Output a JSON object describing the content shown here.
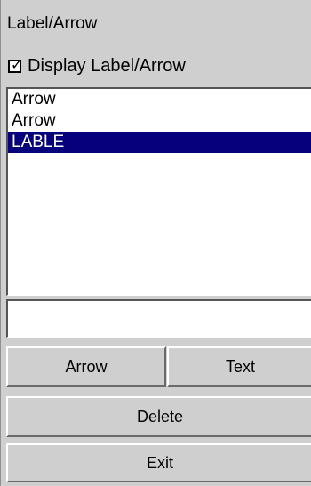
{
  "panel": {
    "title": "Label/Arrow",
    "checkbox": {
      "label": "Display Label/Arrow",
      "checked": true
    },
    "list": {
      "items": [
        {
          "label": "Arrow",
          "selected": false
        },
        {
          "label": "Arrow",
          "selected": false
        },
        {
          "label": "LABLE",
          "selected": true
        }
      ]
    },
    "text_input": {
      "value": "",
      "placeholder": ""
    },
    "buttons": {
      "arrow": "Arrow",
      "text": "Text",
      "delete": "Delete",
      "exit": "Exit"
    }
  },
  "colors": {
    "panel_bg": "#cfcfcf",
    "list_bg": "#ffffff",
    "selection_bg": "#07007c",
    "selection_fg": "#ffffff"
  }
}
